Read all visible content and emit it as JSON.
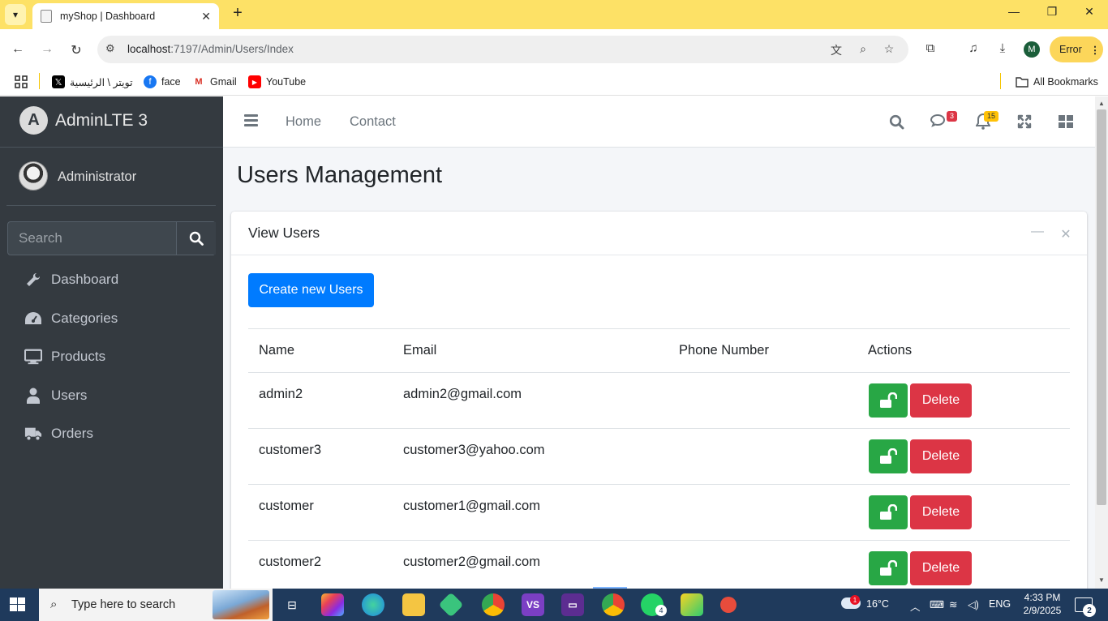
{
  "browser": {
    "tab_title": "myShop | Dashboard",
    "url_host": "localhost",
    "url_rest": ":7197/Admin/Users/Index",
    "profile_initial": "M",
    "error_label": "Error",
    "bookmarks": [
      {
        "label": "تويتر \\ الرئيسية",
        "icon": "x-icon"
      },
      {
        "label": "face",
        "icon": "facebook-icon"
      },
      {
        "label": "Gmail",
        "icon": "gmail-icon"
      },
      {
        "label": "YouTube",
        "icon": "youtube-icon"
      }
    ],
    "all_bookmarks": "All Bookmarks"
  },
  "sidebar": {
    "brand": "AdminLTE 3",
    "brand_logo": "A",
    "user": "Administrator",
    "search_placeholder": "Search",
    "items": [
      {
        "label": "Dashboard",
        "icon": "wrench-icon"
      },
      {
        "label": "Categories",
        "icon": "gauge-icon"
      },
      {
        "label": "Products",
        "icon": "desktop-icon"
      },
      {
        "label": "Users",
        "icon": "user-icon"
      },
      {
        "label": "Orders",
        "icon": "truck-icon"
      }
    ]
  },
  "topnav": {
    "links": [
      "Home",
      "Contact"
    ],
    "messages_count": "3",
    "notifications_count": "15"
  },
  "page": {
    "title": "Users Management",
    "card_title": "View Users",
    "create_button": "Create new Users",
    "columns": [
      "Name",
      "Email",
      "Phone Number",
      "Actions"
    ],
    "rows": [
      {
        "name": "admin2",
        "email": "admin2@gmail.com",
        "phone": ""
      },
      {
        "name": "customer3",
        "email": "customer3@yahoo.com",
        "phone": ""
      },
      {
        "name": "customer",
        "email": "customer1@gmail.com",
        "phone": ""
      },
      {
        "name": "customer2",
        "email": "customer2@gmail.com",
        "phone": ""
      }
    ],
    "delete_label": "Delete"
  },
  "taskbar": {
    "search_placeholder": "Type here to search",
    "weather": "16°C",
    "weather_badge": "1",
    "language": "ENG",
    "time": "4:33 PM",
    "date": "2/9/2025",
    "notifications": "2",
    "whatsapp_badge": "4"
  },
  "colors": {
    "primary": "#007bff",
    "success": "#28a745",
    "danger": "#dc3545",
    "sidebar": "#343a40",
    "tabbar": "#fde166"
  }
}
